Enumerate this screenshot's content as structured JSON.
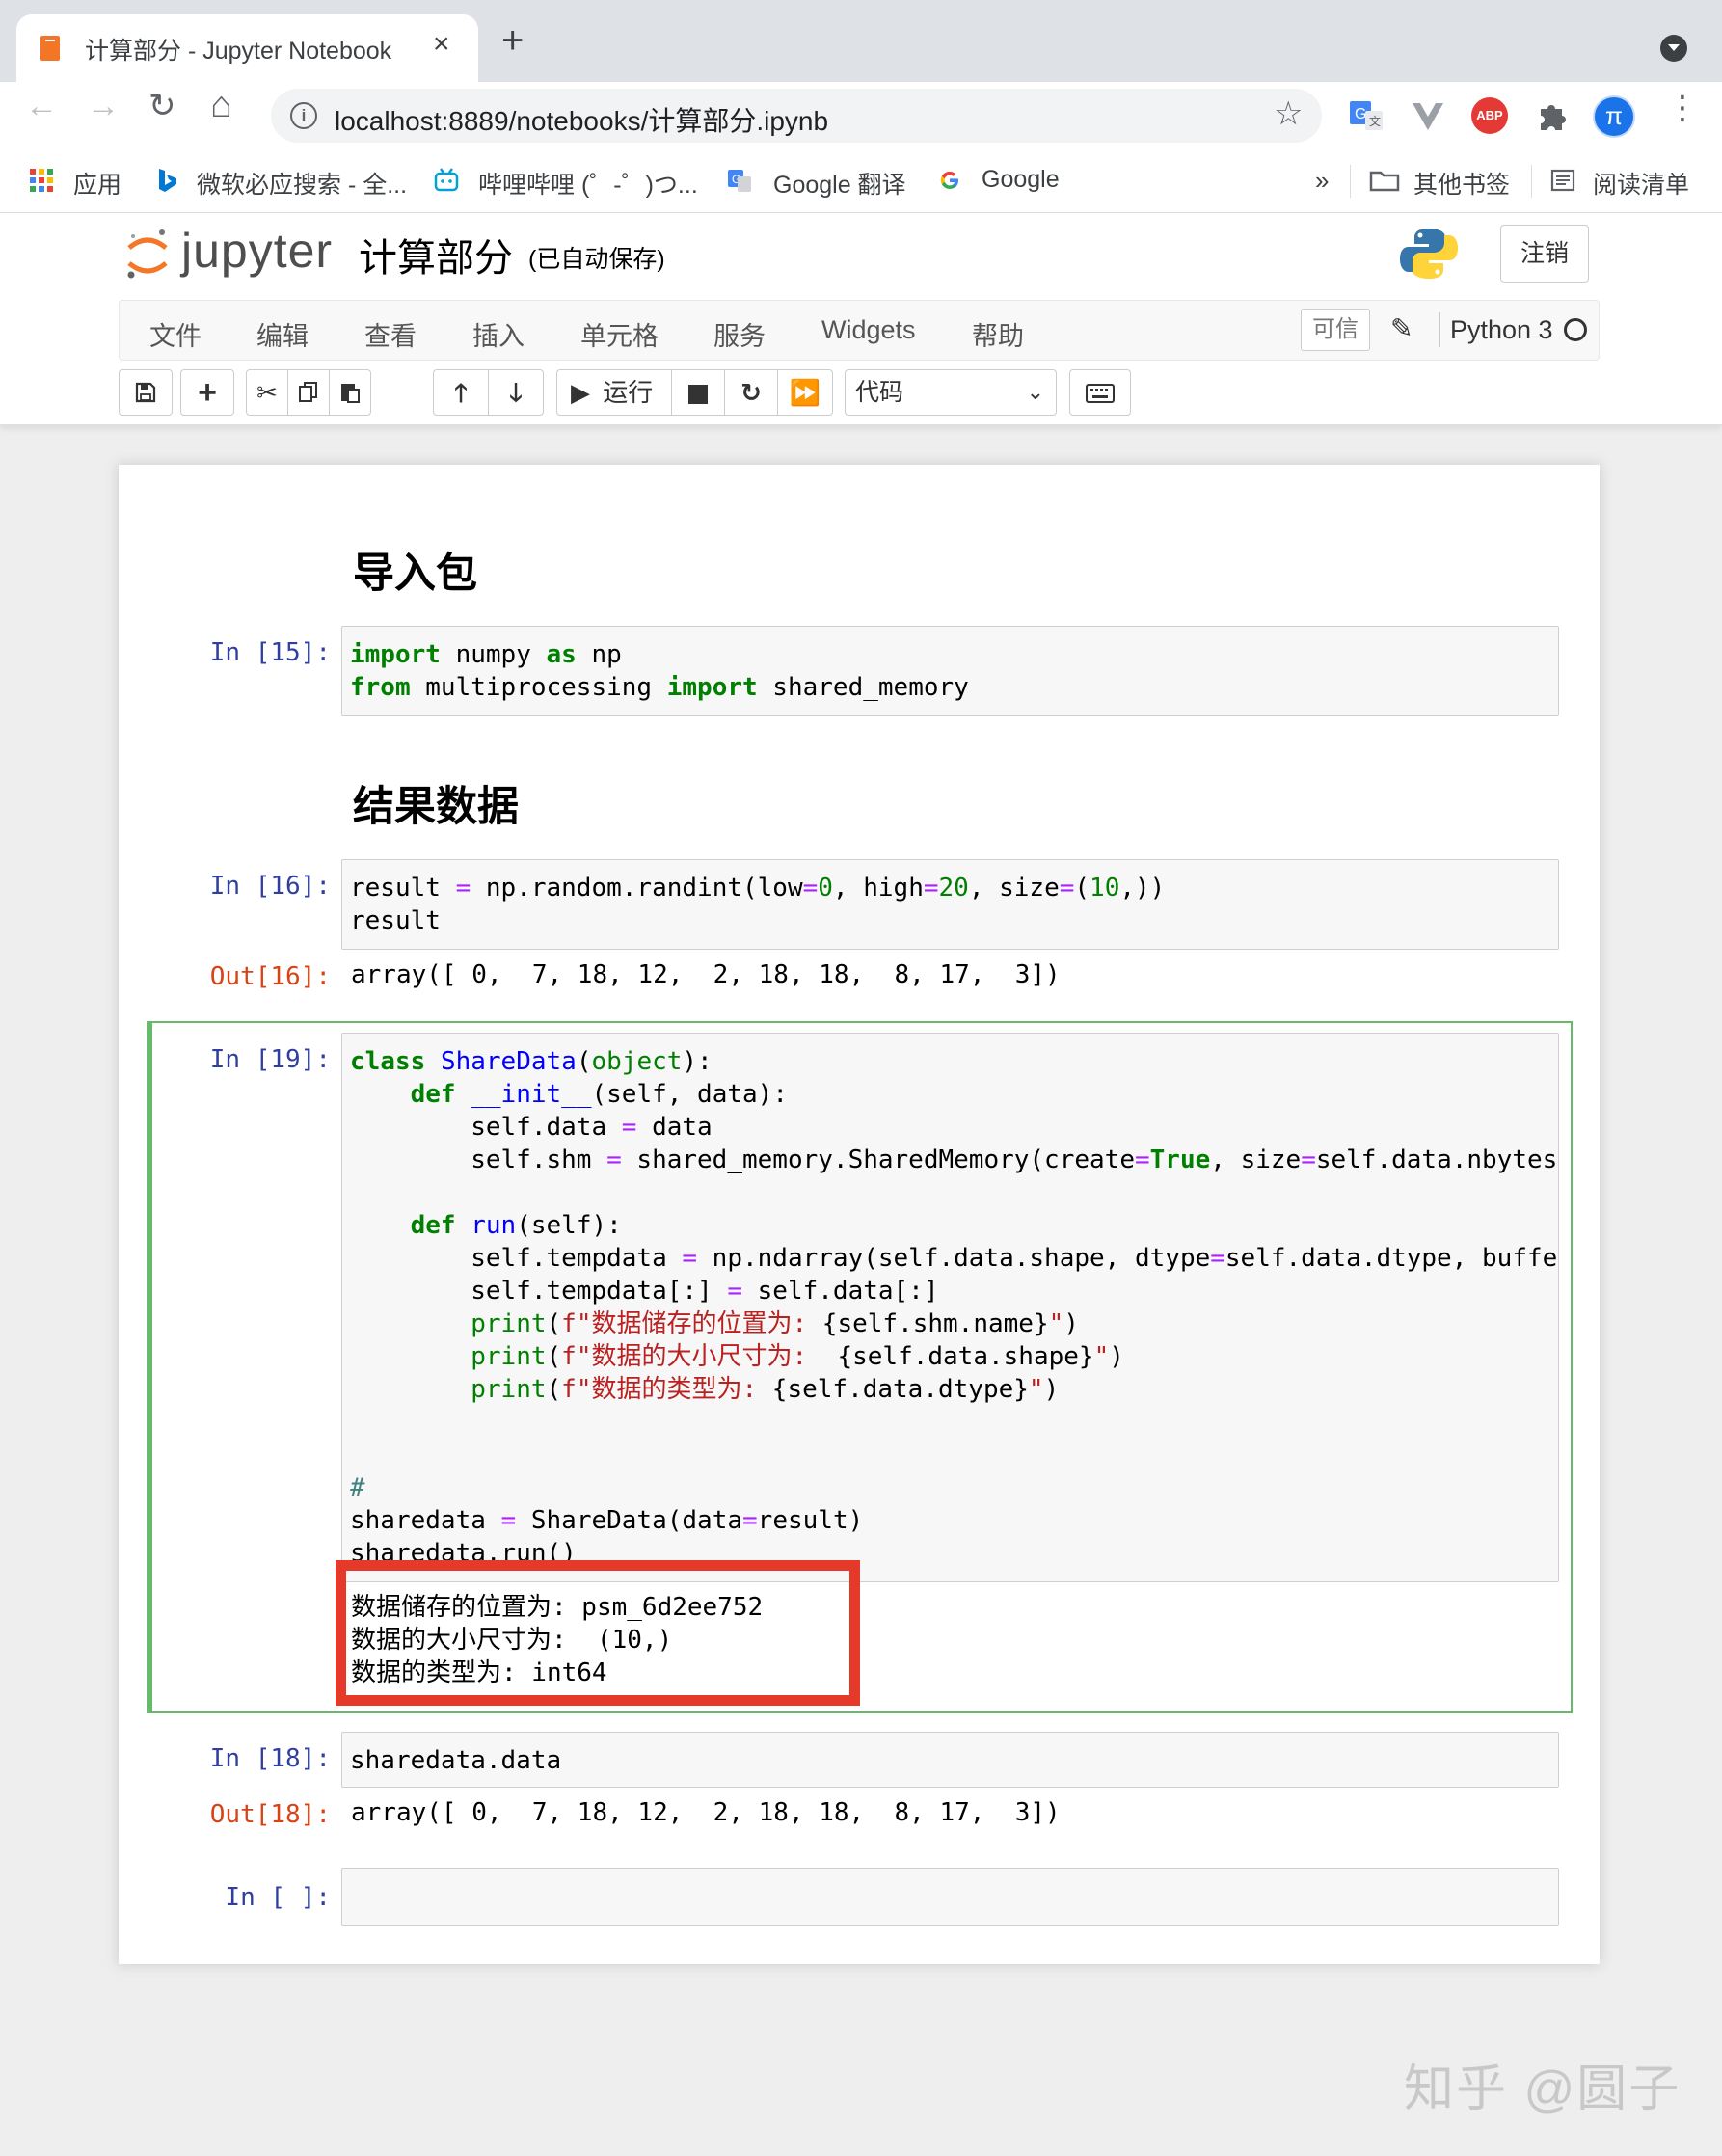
{
  "browser": {
    "tab_title": "计算部分 - Jupyter Notebook",
    "tab_close": "×",
    "new_tab": "+",
    "url": "localhost:8889/notebooks/计算部分.ipynb",
    "nav": {
      "back": "←",
      "forward": "→",
      "reload": "↻",
      "home": "⌂",
      "star": "☆"
    },
    "extensions": {
      "abp_label": "ABP",
      "profile_label": "π"
    },
    "menu_dots": "⋮"
  },
  "bookmarks": {
    "items": [
      "应用",
      "微软必应搜索 - 全...",
      "哔哩哔哩 (゜-゜)つ...",
      "Google 翻译",
      "Google"
    ],
    "overflow": "»",
    "other": "其他书签",
    "reading_list": "阅读清单"
  },
  "jupyter": {
    "logo_text": "jupyter",
    "notebook_title": "计算部分",
    "autosave": "(已自动保存)",
    "logout": "注销",
    "menus": [
      "文件",
      "编辑",
      "查看",
      "插入",
      "单元格",
      "服务",
      "Widgets",
      "帮助"
    ],
    "trusted": "可信",
    "kernel_name": "Python 3",
    "run_label": "运行",
    "cell_type": "代码"
  },
  "notebook": {
    "heading1": "导入包",
    "heading2": "结果数据",
    "cells": [
      {
        "prompt": "In [15]:"
      },
      {
        "prompt": "In [16]:",
        "out_prompt": "Out[16]:",
        "output": "array([ 0,  7, 18, 12,  2, 18, 18,  8, 17,  3])"
      },
      {
        "prompt": "In [19]:",
        "output_lines": [
          "数据储存的位置为: psm_6d2ee752",
          "数据的大小尺寸为:  (10,)",
          "数据的类型为: int64"
        ]
      },
      {
        "prompt": "In [18]:",
        "code": "sharedata.data",
        "out_prompt": "Out[18]:",
        "output": "array([ 0,  7, 18, 12,  2, 18, 18,  8, 17,  3])"
      },
      {
        "prompt": "In [ ]:"
      }
    ]
  },
  "watermark": "知乎 @圆子",
  "colors": {
    "prompt_in": "#303f9f",
    "prompt_out": "#d84315",
    "selected_cell": "#66bb6a",
    "highlight_box": "#e53a2a",
    "keyword": "#008000",
    "string": "#ba2121"
  }
}
